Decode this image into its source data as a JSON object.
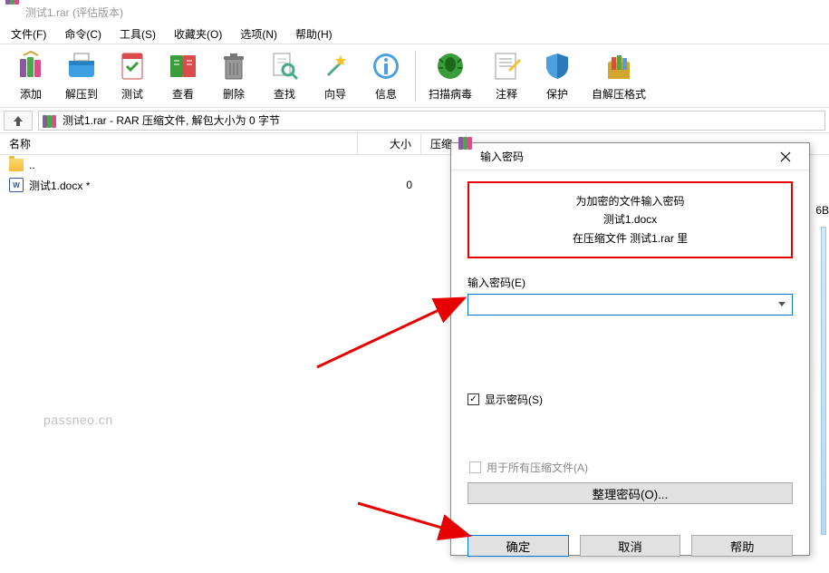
{
  "titlebar": {
    "title": "测试1.rar (评估版本)"
  },
  "menu": {
    "file": "文件(F)",
    "cmd": "命令(C)",
    "tool": "工具(S)",
    "fav": "收藏夹(O)",
    "opt": "选项(N)",
    "help": "帮助(H)"
  },
  "toolbar": {
    "add": "添加",
    "extract": "解压到",
    "test": "测试",
    "view": "查看",
    "delete": "删除",
    "find": "查找",
    "wizard": "向导",
    "info": "信息",
    "scan": "扫描病毒",
    "comment": "注释",
    "protect": "保护",
    "sfx": "自解压格式"
  },
  "path": {
    "text": "测试1.rar - RAR 压缩文件, 解包大小为 0 字节"
  },
  "cols": {
    "name": "名称",
    "size": "大小",
    "packed": "压缩"
  },
  "rows": {
    "up": "..",
    "file1_name": "测试1.docx *",
    "file1_size": "0"
  },
  "truncated": "6B",
  "watermark": "passneo.cn",
  "dialog": {
    "title": "输入密码",
    "line1": "为加密的文件输入密码",
    "line2": "测试1.docx",
    "line3": "在压缩文件 测试1.rar 里",
    "pw_label": "输入密码(E)",
    "show_pw": "显示密码(S)",
    "all_files": "用于所有压缩文件(A)",
    "organize": "整理密码(O)...",
    "ok": "确定",
    "cancel": "取消",
    "help": "帮助"
  }
}
